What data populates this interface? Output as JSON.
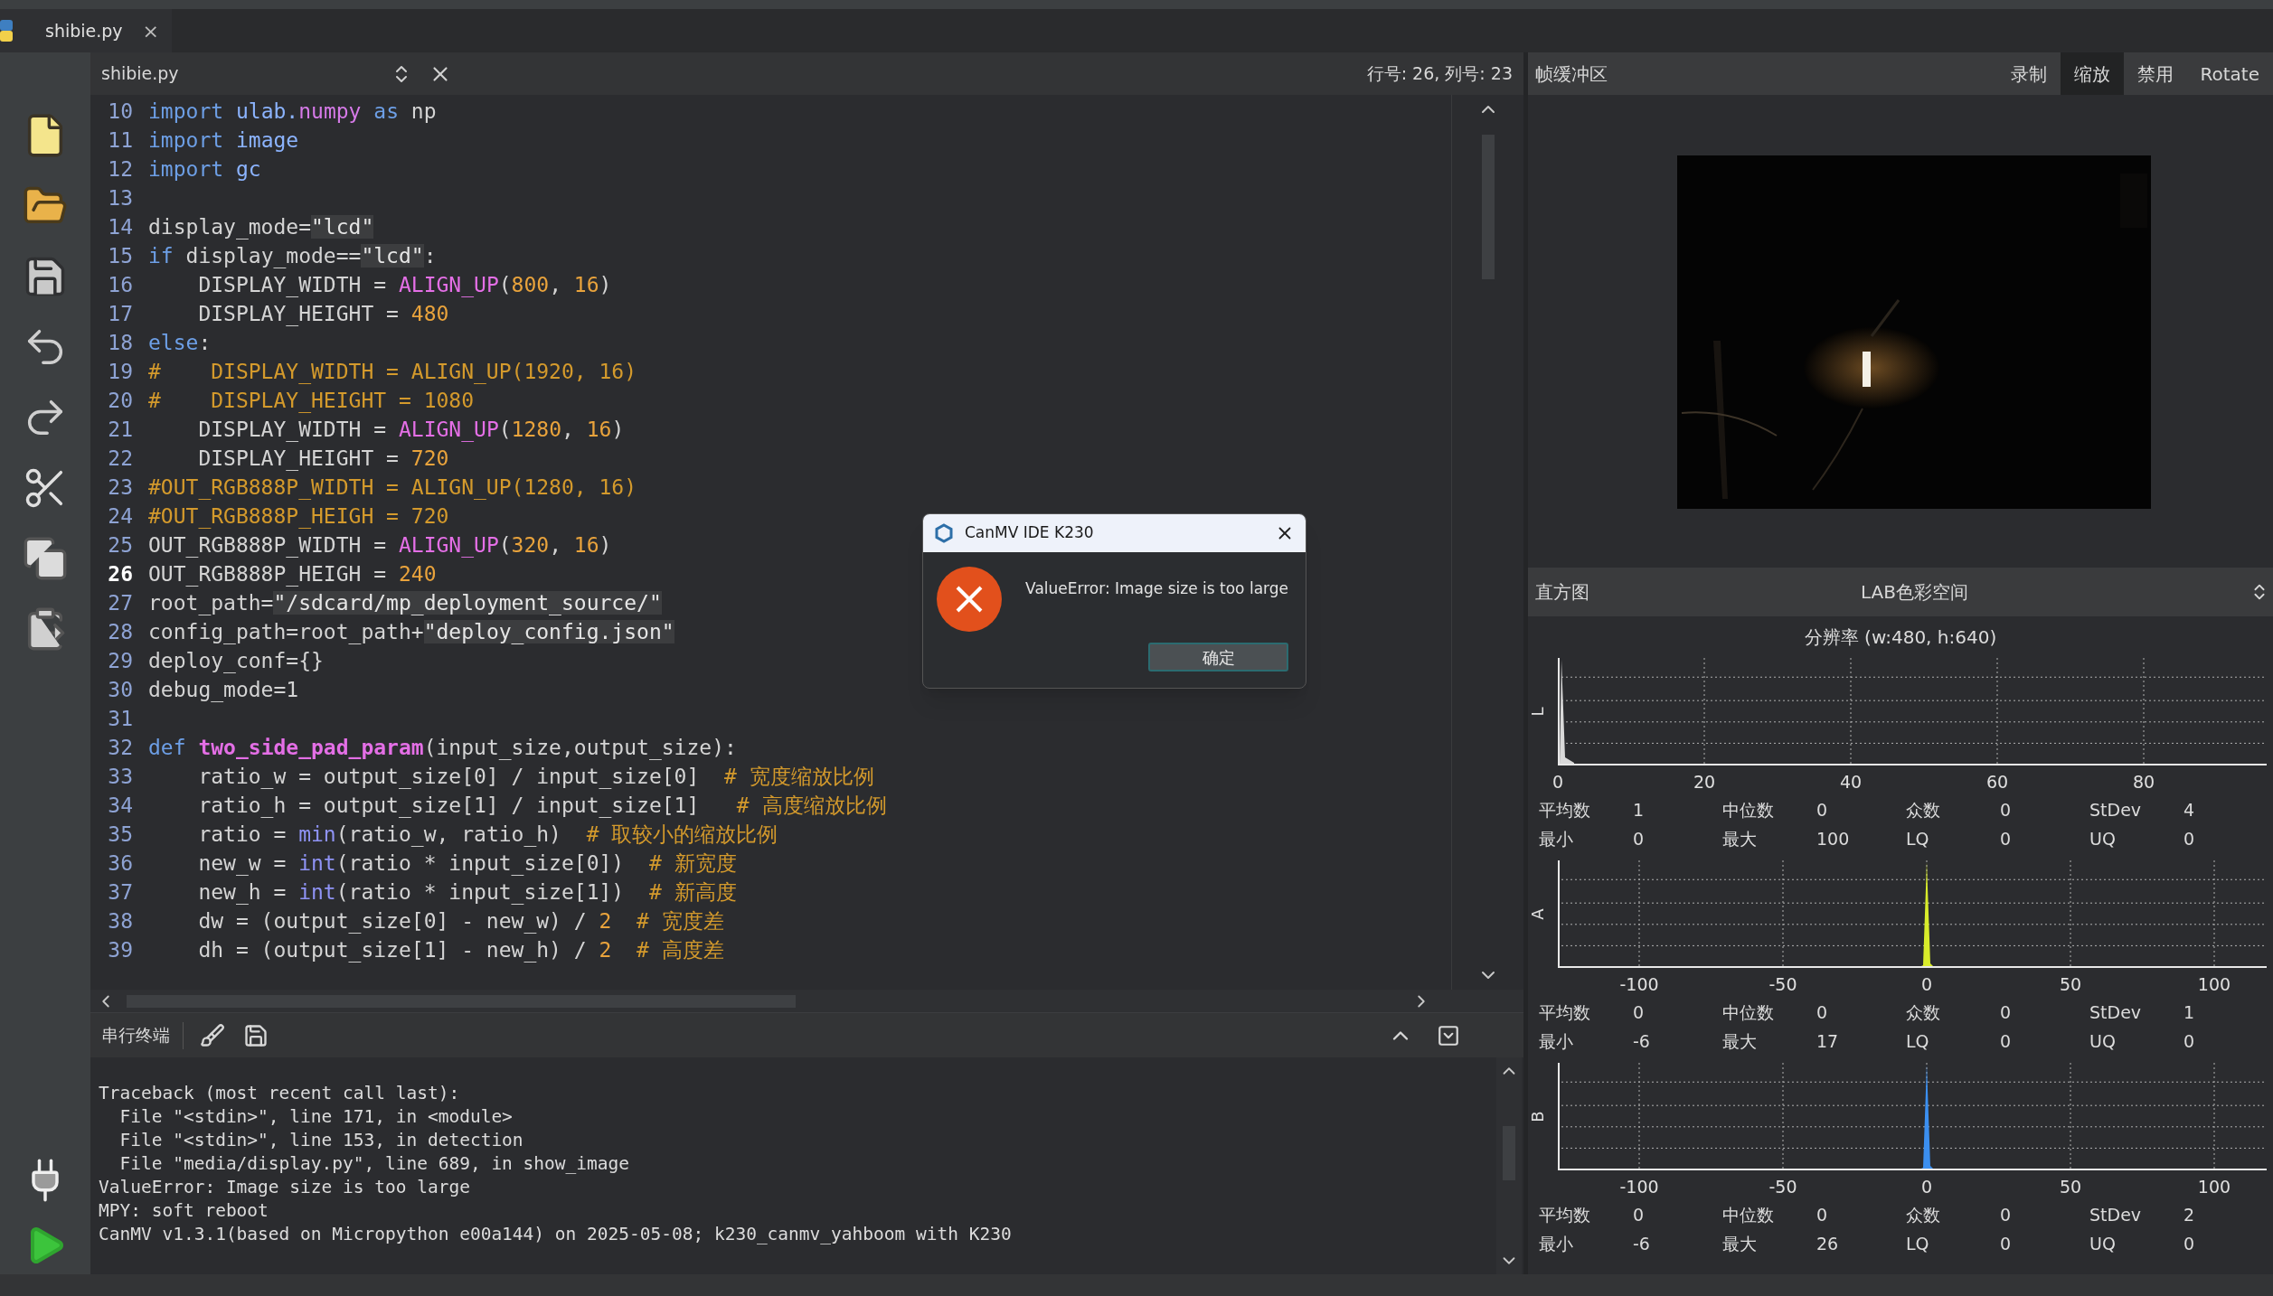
{
  "tab": {
    "label": "shibie.py",
    "close": "×"
  },
  "editor": {
    "file": "shibie.py",
    "position": "行号: 26, 列号: 23",
    "lines": [
      {
        "n": "10",
        "current": false,
        "tokens": [
          {
            "text": "import",
            "kind": "keyword"
          },
          {
            "text": " ulab.",
            "kind": "module"
          },
          {
            "text": "numpy ",
            "kind": "attr"
          },
          {
            "text": "as",
            "kind": "keyword"
          },
          {
            "text": " np",
            "kind": "plain"
          }
        ]
      },
      {
        "n": "11",
        "current": false,
        "tokens": [
          {
            "text": "import",
            "kind": "keyword"
          },
          {
            "text": " image",
            "kind": "module"
          }
        ]
      },
      {
        "n": "12",
        "current": false,
        "tokens": [
          {
            "text": "import",
            "kind": "keyword"
          },
          {
            "text": " gc",
            "kind": "module"
          }
        ]
      },
      {
        "n": "13",
        "current": false
      },
      {
        "n": "14",
        "current": false,
        "tokens": [
          {
            "text": "display_mode=",
            "kind": "plain"
          },
          {
            "text": "\"lcd\"",
            "kind": "string"
          }
        ]
      },
      {
        "n": "15",
        "current": false,
        "tokens": [
          {
            "text": "if",
            "kind": "keyword"
          },
          {
            "text": " display_mode==",
            "kind": "plain"
          },
          {
            "text": "\"lcd\"",
            "kind": "string"
          },
          {
            "text": ":",
            "kind": "plain"
          }
        ]
      },
      {
        "n": "16",
        "current": false,
        "tokens": [
          {
            "text": "    DISPLAY_WIDTH = ",
            "kind": "plain"
          },
          {
            "text": "ALIGN_UP",
            "kind": "func"
          },
          {
            "text": "(",
            "kind": "plain"
          },
          {
            "text": "800",
            "kind": "number"
          },
          {
            "text": ", ",
            "kind": "plain"
          },
          {
            "text": "16",
            "kind": "number"
          },
          {
            "text": ")",
            "kind": "plain"
          }
        ]
      },
      {
        "n": "17",
        "current": false,
        "tokens": [
          {
            "text": "    DISPLAY_HEIGHT = ",
            "kind": "plain"
          },
          {
            "text": "480",
            "kind": "number"
          }
        ]
      },
      {
        "n": "18",
        "current": false,
        "tokens": [
          {
            "text": "else",
            "kind": "keyword"
          },
          {
            "text": ":",
            "kind": "plain"
          }
        ]
      },
      {
        "n": "19",
        "current": false,
        "tokens": [
          {
            "text": "#    DISPLAY_WIDTH = ALIGN_UP(1920, 16)",
            "kind": "comment"
          }
        ]
      },
      {
        "n": "20",
        "current": false,
        "tokens": [
          {
            "text": "#    DISPLAY_HEIGHT = 1080",
            "kind": "comment"
          }
        ]
      },
      {
        "n": "21",
        "current": false,
        "tokens": [
          {
            "text": "    DISPLAY_WIDTH = ",
            "kind": "plain"
          },
          {
            "text": "ALIGN_UP",
            "kind": "func"
          },
          {
            "text": "(",
            "kind": "plain"
          },
          {
            "text": "1280",
            "kind": "number"
          },
          {
            "text": ", ",
            "kind": "plain"
          },
          {
            "text": "16",
            "kind": "number"
          },
          {
            "text": ")",
            "kind": "plain"
          }
        ]
      },
      {
        "n": "22",
        "current": false,
        "tokens": [
          {
            "text": "    DISPLAY_HEIGHT = ",
            "kind": "plain"
          },
          {
            "text": "720",
            "kind": "number"
          }
        ]
      },
      {
        "n": "23",
        "current": false,
        "tokens": [
          {
            "text": "#OUT_RGB888P_WIDTH = ALIGN_UP(1280, 16)",
            "kind": "comment"
          }
        ]
      },
      {
        "n": "24",
        "current": false,
        "tokens": [
          {
            "text": "#OUT_RGB888P_HEIGH = 720",
            "kind": "comment"
          }
        ]
      },
      {
        "n": "25",
        "current": false,
        "tokens": [
          {
            "text": "OUT_RGB888P_WIDTH = ",
            "kind": "plain"
          },
          {
            "text": "ALIGN_UP",
            "kind": "func"
          },
          {
            "text": "(",
            "kind": "plain"
          },
          {
            "text": "320",
            "kind": "number"
          },
          {
            "text": ", ",
            "kind": "plain"
          },
          {
            "text": "16",
            "kind": "number"
          },
          {
            "text": ")",
            "kind": "plain"
          }
        ]
      },
      {
        "n": "26",
        "current": true,
        "tokens": [
          {
            "text": "OUT_RGB888P_HEIGH = ",
            "kind": "plain"
          },
          {
            "text": "240",
            "kind": "number"
          }
        ]
      },
      {
        "n": "27",
        "current": false,
        "tokens": [
          {
            "text": "root_path=",
            "kind": "plain"
          },
          {
            "text": "\"/sdcard/mp_deployment_source/\"",
            "kind": "string"
          }
        ]
      },
      {
        "n": "28",
        "current": false,
        "tokens": [
          {
            "text": "config_path=root_path+",
            "kind": "plain"
          },
          {
            "text": "\"deploy_config.json\"",
            "kind": "string"
          }
        ]
      },
      {
        "n": "29",
        "current": false,
        "tokens": [
          {
            "text": "deploy_conf={}",
            "kind": "plain"
          }
        ]
      },
      {
        "n": "30",
        "current": false,
        "tokens": [
          {
            "text": "debug_mode=1",
            "kind": "plain"
          }
        ]
      },
      {
        "n": "31",
        "current": false
      },
      {
        "n": "32",
        "current": false,
        "tokens": [
          {
            "text": "def ",
            "kind": "keyword"
          },
          {
            "text": "two_side_pad_param",
            "kind": "defname"
          },
          {
            "text": "(input_size,output_size):",
            "kind": "plain"
          }
        ]
      },
      {
        "n": "33",
        "current": false,
        "tokens": [
          {
            "text": "    ratio_w = output_size[0] / input_size[0]  ",
            "kind": "plain"
          },
          {
            "text": "# 宽度缩放比例",
            "kind": "comment"
          }
        ]
      },
      {
        "n": "34",
        "current": false,
        "tokens": [
          {
            "text": "    ratio_h = output_size[1] / input_size[1]   ",
            "kind": "plain"
          },
          {
            "text": "# 高度缩放比例",
            "kind": "comment"
          }
        ]
      },
      {
        "n": "35",
        "current": false,
        "tokens": [
          {
            "text": "    ratio = ",
            "kind": "plain"
          },
          {
            "text": "min",
            "kind": "builtin"
          },
          {
            "text": "(ratio_w, ratio_h)  ",
            "kind": "plain"
          },
          {
            "text": "# 取较小的缩放比例",
            "kind": "comment"
          }
        ]
      },
      {
        "n": "36",
        "current": false,
        "tokens": [
          {
            "text": "    new_w = ",
            "kind": "plain"
          },
          {
            "text": "int",
            "kind": "builtin"
          },
          {
            "text": "(ratio * input_size[0])  ",
            "kind": "plain"
          },
          {
            "text": "# 新宽度",
            "kind": "comment"
          }
        ]
      },
      {
        "n": "37",
        "current": false,
        "tokens": [
          {
            "text": "    new_h = ",
            "kind": "plain"
          },
          {
            "text": "int",
            "kind": "builtin"
          },
          {
            "text": "(ratio * input_size[1])  ",
            "kind": "plain"
          },
          {
            "text": "# 新高度",
            "kind": "comment"
          }
        ]
      },
      {
        "n": "38",
        "current": false,
        "tokens": [
          {
            "text": "    dw = (output_size[0] - new_w) / ",
            "kind": "plain"
          },
          {
            "text": "2  ",
            "kind": "number"
          },
          {
            "text": "# 宽度差",
            "kind": "comment"
          }
        ]
      },
      {
        "n": "39",
        "current": false,
        "tokens": [
          {
            "text": "    dh = (output_size[1] - new_h) / ",
            "kind": "plain"
          },
          {
            "text": "2  ",
            "kind": "number"
          },
          {
            "text": "# 高度差",
            "kind": "comment"
          }
        ]
      }
    ]
  },
  "terminal": {
    "title": "串行终端",
    "lines": [
      "Traceback (most recent call last):",
      "  File \"<stdin>\", line 171, in <module>",
      "  File \"<stdin>\", line 153, in detection",
      "  File \"media/display.py\", line 689, in show_image",
      "ValueError: Image size is too large",
      "MPY: soft reboot",
      "CanMV v1.3.1(based on Micropython e00a144) on 2025-05-08; k230_canmv_yahboom with K230"
    ]
  },
  "framebuffer": {
    "title": "帧缓冲区",
    "buttons": [
      {
        "label": "录制",
        "selected": false
      },
      {
        "label": "缩放",
        "selected": true
      },
      {
        "label": "禁用",
        "selected": false
      },
      {
        "label": "Rotate",
        "selected": false
      }
    ]
  },
  "histogram": {
    "title": "直方图",
    "colorspace": "LAB色彩空间",
    "resolution": "分辨率 (w:480, h:640)",
    "channels": [
      {
        "axis": "L",
        "kind": "lightness",
        "color": "#d9d9d9",
        "ticks": [
          "0",
          "20",
          "40",
          "60",
          "80"
        ],
        "stats": [
          [
            {
              "label": "平均数",
              "value": "1"
            },
            {
              "label": "中位数",
              "value": "0"
            },
            {
              "label": "众数",
              "value": "0"
            },
            {
              "label": "StDev",
              "value": "4"
            }
          ],
          [
            {
              "label": "最小",
              "value": "0"
            },
            {
              "label": "最大",
              "value": "100"
            },
            {
              "label": "LQ",
              "value": "0"
            },
            {
              "label": "UQ",
              "value": "0"
            }
          ]
        ]
      },
      {
        "axis": "A",
        "kind": "chroma",
        "color": "#d8ec2a",
        "ticks": [
          "-100",
          "-50",
          "0",
          "50",
          "100"
        ],
        "stats": [
          [
            {
              "label": "平均数",
              "value": "0"
            },
            {
              "label": "中位数",
              "value": "0"
            },
            {
              "label": "众数",
              "value": "0"
            },
            {
              "label": "StDev",
              "value": "1"
            }
          ],
          [
            {
              "label": "最小",
              "value": "-6"
            },
            {
              "label": "最大",
              "value": "17"
            },
            {
              "label": "LQ",
              "value": "0"
            },
            {
              "label": "UQ",
              "value": "0"
            }
          ]
        ]
      },
      {
        "axis": "B",
        "kind": "chroma",
        "color": "#3b8ff0",
        "ticks": [
          "-100",
          "-50",
          "0",
          "50",
          "100"
        ],
        "stats": [
          [
            {
              "label": "平均数",
              "value": "0"
            },
            {
              "label": "中位数",
              "value": "0"
            },
            {
              "label": "众数",
              "value": "0"
            },
            {
              "label": "StDev",
              "value": "2"
            }
          ],
          [
            {
              "label": "最小",
              "value": "-6"
            },
            {
              "label": "最大",
              "value": "26"
            },
            {
              "label": "LQ",
              "value": "0"
            },
            {
              "label": "UQ",
              "value": "0"
            }
          ]
        ]
      }
    ]
  },
  "dialog": {
    "title": "CanMV IDE K230",
    "message": "ValueError: Image size is too large",
    "button": "确定"
  }
}
